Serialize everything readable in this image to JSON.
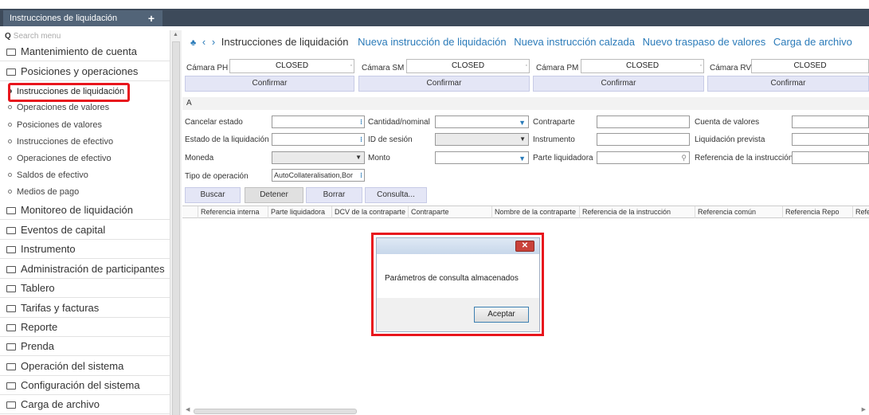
{
  "tabs": [
    {
      "label": "Instrucciones de liquidación"
    }
  ],
  "sidebar": {
    "search_placeholder": "Search menu",
    "items": [
      {
        "label": "Mantenimiento de cuenta"
      },
      {
        "label": "Posiciones y operaciones"
      },
      {
        "label": "Monitoreo de liquidación"
      },
      {
        "label": "Eventos de capital"
      },
      {
        "label": "Instrumento"
      },
      {
        "label": "Administración de participantes"
      },
      {
        "label": "Tablero"
      },
      {
        "label": "Tarifas y facturas"
      },
      {
        "label": "Reporte"
      },
      {
        "label": "Prenda"
      },
      {
        "label": "Operación del sistema"
      },
      {
        "label": "Configuración del sistema"
      },
      {
        "label": "Carga de archivo"
      }
    ],
    "subitems": [
      {
        "label": "Instrucciones de liquidación"
      },
      {
        "label": "Operaciones de valores"
      },
      {
        "label": "Posiciones de valores"
      },
      {
        "label": "Instrucciones de efectivo"
      },
      {
        "label": "Operaciones de efectivo"
      },
      {
        "label": "Saldos de efectivo"
      },
      {
        "label": "Medios de pago"
      }
    ]
  },
  "breadcrumb": {
    "current": "Instrucciones de liquidación",
    "links": [
      "Nueva instrucción de liquidación",
      "Nueva instrucción calzada",
      "Nuevo traspaso de valores",
      "Carga de archivo"
    ]
  },
  "camaras": [
    {
      "label": "Cámara PH",
      "status": "CLOSED",
      "button": "Confirmar"
    },
    {
      "label": "Cámara SM",
      "status": "CLOSED",
      "button": "Confirmar"
    },
    {
      "label": "Cámara PM",
      "status": "CLOSED",
      "button": "Confirmar"
    },
    {
      "label": "Cámara RV",
      "status": "CLOSED",
      "button": "Confirmar"
    }
  ],
  "section_label": "A",
  "filters": {
    "cancelar_estado": "Cancelar estado",
    "estado_liquidacion": "Estado de la liquidación",
    "moneda": "Moneda",
    "tipo_operacion": "Tipo de operación",
    "tipo_operacion_value": "AutoCollateralisation,Bor",
    "cantidad_nominal": "Cantidad/nominal",
    "id_sesion": "ID de sesión",
    "monto": "Monto",
    "contraparte": "Contraparte",
    "instrumento": "Instrumento",
    "parte_liquidadora": "Parte liquidadora",
    "cuenta_valores": "Cuenta de valores",
    "liquidacion_prevista": "Liquidación prevista",
    "referencia_instruccion": "Referencia de la instrucción"
  },
  "actions": {
    "buscar": "Buscar",
    "detener": "Detener",
    "borrar": "Borrar",
    "consulta": "Consulta..."
  },
  "grid": {
    "columns": [
      "Referencia interna",
      "Parte liquidadora",
      "DCV de la contraparte",
      "Contraparte",
      "Nombre de la contraparte",
      "Referencia de la instrucción",
      "Referencia común",
      "Referencia Repo",
      "Refe"
    ]
  },
  "dialog": {
    "message": "Parámetros de consulta almacenados",
    "ok_label": "Aceptar"
  },
  "colors": {
    "accent": "#2b7bb9",
    "highlight": "#e8161d",
    "topbar": "#3d4a5a"
  }
}
